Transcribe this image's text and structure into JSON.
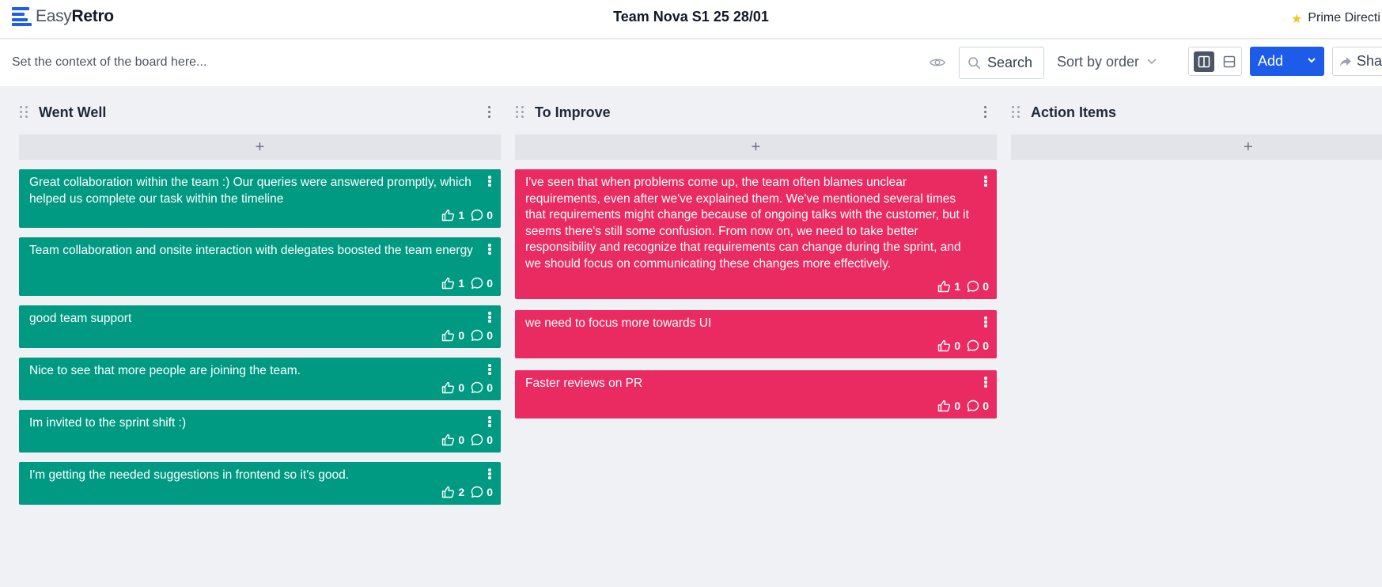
{
  "brand": {
    "name_light": "Easy",
    "name_bold": "Retro",
    "accent": "#1f5eea"
  },
  "board": {
    "title": "Team Nova S1 25 28/01"
  },
  "prime_directive": {
    "label": "Prime Directi",
    "icon": "star-icon"
  },
  "toolbar": {
    "context_placeholder": "Set the context of the board here...",
    "search_label": "Search",
    "sort_label": "Sort by order",
    "add_label": "Add",
    "share_label": "Sha"
  },
  "colors": {
    "went_well": "#009a83",
    "to_improve": "#e92b62",
    "primary": "#1d5ce8"
  },
  "columns": [
    {
      "title": "Went Well",
      "add_symbol": "+",
      "cards": [
        {
          "text": "Great collaboration within the team :) Our queries were answered promptly, which helped us complete our task within the timeline",
          "likes": "1",
          "comments": "0"
        },
        {
          "text": "Team collaboration and onsite interaction with delegates boosted the team energy",
          "likes": "1",
          "comments": "0"
        },
        {
          "text": "good team support",
          "likes": "0",
          "comments": "0"
        },
        {
          "text": "Nice to see that more people are joining the team.",
          "likes": "0",
          "comments": "0"
        },
        {
          "text": "Im invited to the sprint shift :)",
          "likes": "0",
          "comments": "0"
        },
        {
          "text": "I'm getting the needed suggestions in frontend so it's good.",
          "likes": "2",
          "comments": "0"
        }
      ]
    },
    {
      "title": "To Improve",
      "add_symbol": "+",
      "cards": [
        {
          "text": "I've seen that when problems come up, the team often blames unclear requirements, even after we've explained them. We've mentioned several times that requirements might change because of ongoing talks with the customer, but it seems there's still some confusion. From now on, we need to take better responsibility and recognize that requirements can change during the sprint, and we should focus on communicating these changes more effectively.",
          "likes": "1",
          "comments": "0"
        },
        {
          "text": "we need to focus more towards UI",
          "likes": "0",
          "comments": "0"
        },
        {
          "text": "Faster reviews on PR",
          "likes": "0",
          "comments": "0"
        }
      ]
    },
    {
      "title": "Action Items",
      "add_symbol": "+",
      "cards": []
    }
  ]
}
